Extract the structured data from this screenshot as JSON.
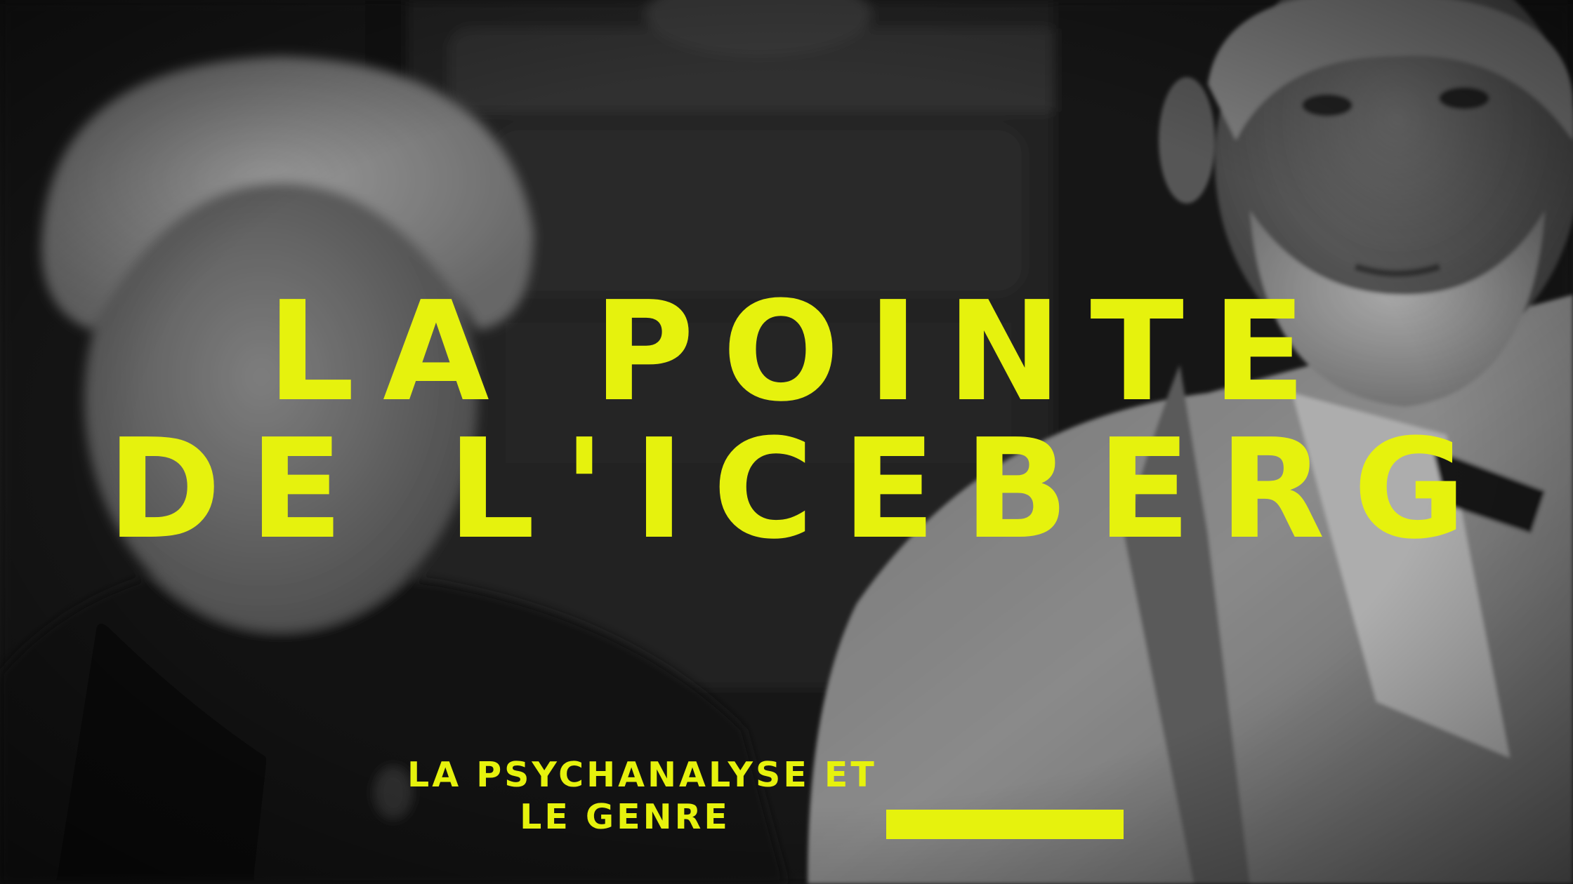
{
  "title": {
    "line1": "LA POINTE",
    "line2": "DE L'ICEBERG"
  },
  "subtitle": {
    "line1": "LA PSYCHANALYSE ET",
    "line2": "LE GENRE"
  },
  "colors": {
    "accent": "#e6f20d",
    "background": "#1b1b1b"
  }
}
